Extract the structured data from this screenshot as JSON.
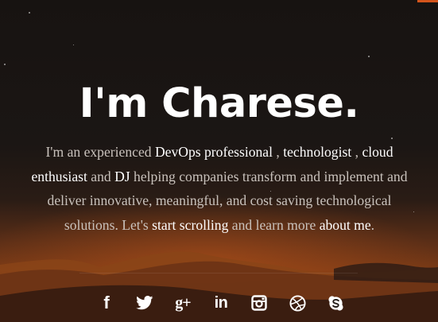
{
  "hero": {
    "title": "I'm Charese.",
    "intro": {
      "t1": "I'm an experienced ",
      "h1": "DevOps professional",
      "t2": " , ",
      "h2": "technologist",
      "t3": " , ",
      "h3": "cloud enthusiast",
      "t4": " and ",
      "h4": "DJ",
      "t5": " helping companies transform and implement and deliver innovative, meaningful, and cost saving technological solutions. Let's ",
      "link1": "start scrolling",
      "t6": " and learn more ",
      "link2": "about me",
      "t7": "."
    }
  },
  "social": {
    "icons": [
      "facebook-icon",
      "twitter-icon",
      "google-plus-icon",
      "linkedin-icon",
      "instagram-icon",
      "dribbble-icon",
      "skype-icon"
    ],
    "facebook_glyph": "f",
    "googleplus_glyph": "g+",
    "linkedin_glyph": "in"
  },
  "colors": {
    "accent": "#d4551c",
    "text_white": "#ffffff",
    "text_muted": "#c9c2bc"
  }
}
